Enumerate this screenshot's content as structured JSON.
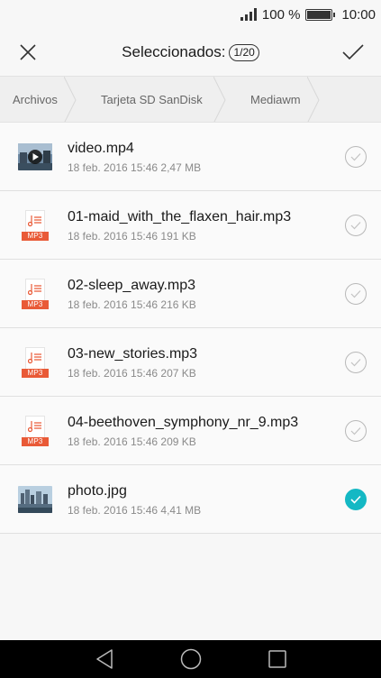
{
  "status_bar": {
    "battery_text": "100 %",
    "time": "10:00"
  },
  "header": {
    "title": "Seleccionados:",
    "count": "1/20",
    "close_icon": "close-icon",
    "confirm_icon": "checkmark-icon"
  },
  "breadcrumb": {
    "items": [
      "Archivos",
      "Tarjeta SD SanDisk",
      "Mediawm"
    ]
  },
  "files": [
    {
      "name": "video.mp4",
      "meta": "18 feb. 2016 15:46 2,47 MB",
      "type": "video",
      "selected": false
    },
    {
      "name": "01-maid_with_the_flaxen_hair.mp3",
      "meta": "18 feb. 2016 15:46 191 KB",
      "type": "mp3",
      "selected": false
    },
    {
      "name": "02-sleep_away.mp3",
      "meta": "18 feb. 2016 15:46 216 KB",
      "type": "mp3",
      "selected": false
    },
    {
      "name": "03-new_stories.mp3",
      "meta": "18 feb. 2016 15:46 207 KB",
      "type": "mp3",
      "selected": false
    },
    {
      "name": "04-beethoven_symphony_nr_9.mp3",
      "meta": "18 feb. 2016 15:46 209 KB",
      "type": "mp3",
      "selected": false
    },
    {
      "name": "photo.jpg",
      "meta": "18 feb. 2016 15:46 4,41 MB",
      "type": "image",
      "selected": true
    }
  ],
  "mp3_tag": "MP3",
  "colors": {
    "accent": "#14b8c4",
    "mp3_tag": "#e95a37"
  },
  "nav_bar": {
    "icons": [
      "back-triangle-icon",
      "home-circle-icon",
      "recents-square-icon"
    ]
  }
}
